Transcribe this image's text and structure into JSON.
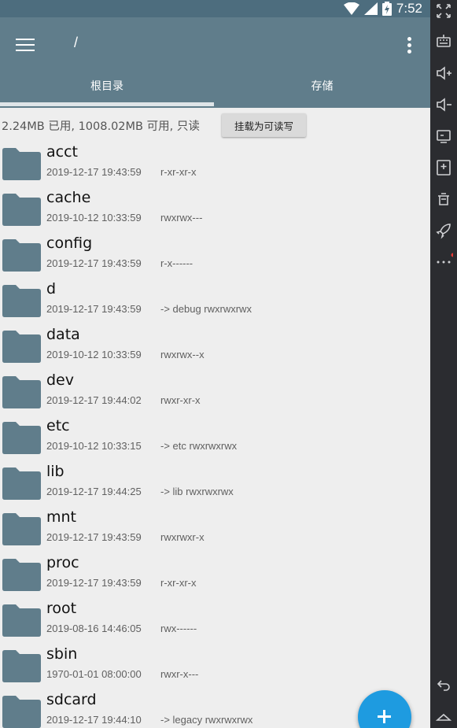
{
  "status_bar": {
    "time": "7:52",
    "icons": [
      "wifi-icon",
      "signal-icon",
      "battery-icon"
    ]
  },
  "app_bar": {
    "menu_icon": "hamburger-menu-icon",
    "path": "/",
    "overflow_icon": "more-vert-icon",
    "tabs": [
      {
        "label": "根目录",
        "selected": true
      },
      {
        "label": "存储",
        "selected": false
      }
    ]
  },
  "info_bar": {
    "usage_text": "2.24MB 已用, 1008.02MB 可用, 只读",
    "mount_button_label": "挂载为可读写"
  },
  "files": [
    {
      "name": "acct",
      "date": "2019-12-17 19:43:59",
      "info": "r-xr-xr-x"
    },
    {
      "name": "cache",
      "date": "2019-10-12 10:33:59",
      "info": "rwxrwx---"
    },
    {
      "name": "config",
      "date": "2019-12-17 19:43:59",
      "info": "r-x------"
    },
    {
      "name": "d",
      "date": "2019-12-17 19:43:59",
      "info": "-> debug  rwxrwxrwx"
    },
    {
      "name": "data",
      "date": "2019-10-12 10:33:59",
      "info": "rwxrwx--x"
    },
    {
      "name": "dev",
      "date": "2019-12-17 19:44:02",
      "info": "rwxr-xr-x"
    },
    {
      "name": "etc",
      "date": "2019-10-12 10:33:15",
      "info": "-> etc  rwxrwxrwx"
    },
    {
      "name": "lib",
      "date": "2019-12-17 19:44:25",
      "info": "-> lib  rwxrwxrwx"
    },
    {
      "name": "mnt",
      "date": "2019-12-17 19:43:59",
      "info": "rwxrwxr-x"
    },
    {
      "name": "proc",
      "date": "2019-12-17 19:43:59",
      "info": "r-xr-xr-x"
    },
    {
      "name": "root",
      "date": "2019-08-16 14:46:05",
      "info": "rwx------"
    },
    {
      "name": "sbin",
      "date": "1970-01-01 08:00:00",
      "info": "rwxr-x---"
    },
    {
      "name": "sdcard",
      "date": "2019-12-17 19:44:10",
      "info": "-> legacy  rwxrwxrwx"
    }
  ],
  "fab": {
    "icon": "add-icon"
  },
  "emulator_sidebar": {
    "buttons": [
      "fullscreen-icon",
      "keyboard-icon",
      "volume-up-icon",
      "volume-down-icon",
      "screen-icon",
      "apk-install-icon",
      "delete-icon",
      "rocket-icon",
      "more-icon",
      "back-icon",
      "home-icon"
    ]
  },
  "colors": {
    "app_bar": "#607d8b",
    "status_bar": "#4d6d7e",
    "folder": "#607d8b",
    "fab": "#1e9be0",
    "background": "#eeeeee"
  }
}
